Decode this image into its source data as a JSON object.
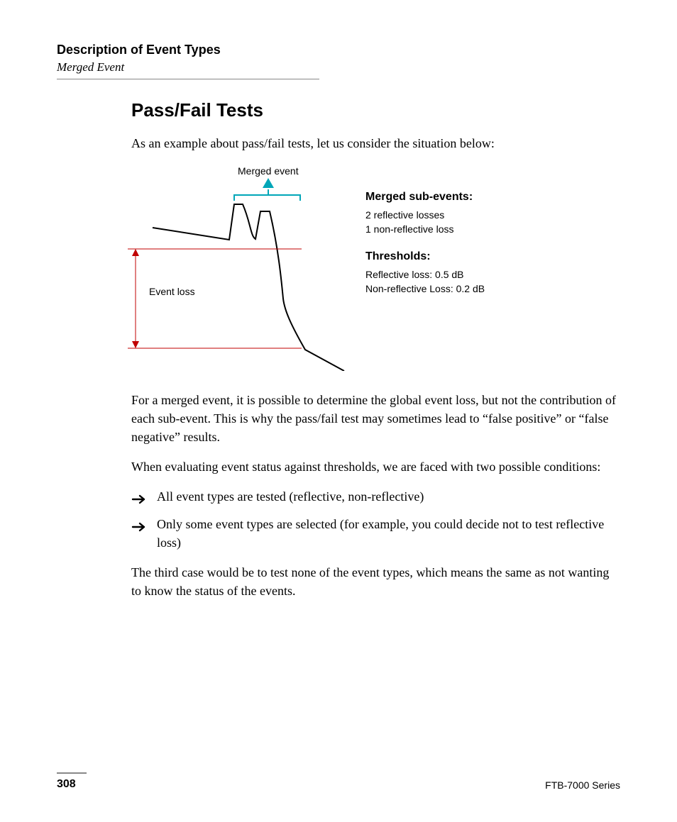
{
  "header": {
    "section_title": "Description of Event Types",
    "section_sub": "Merged Event"
  },
  "title": "Pass/Fail Tests",
  "intro": "As an example about pass/fail tests, let us consider the situation below:",
  "figure": {
    "merged_label": "Merged event",
    "event_loss_label": "Event loss"
  },
  "side": {
    "h1": "Merged sub-events:",
    "l1": "2 reflective losses",
    "l2": "1 non-reflective loss",
    "h2": "Thresholds:",
    "l3": "Reflective loss: 0.5 dB",
    "l4": "Non-reflective Loss: 0.2 dB"
  },
  "para1": "For a merged event, it is possible to determine the global event loss, but not the contribution of each sub-event. This is why the pass/fail test may sometimes lead to “false positive” or “false negative” results.",
  "para2": "When evaluating event status against thresholds, we are faced with two possible conditions:",
  "bullets": [
    "All event types are tested (reflective, non-reflective)",
    "Only some event types are selected (for example, you could decide not to test reflective loss)"
  ],
  "para3": "The third case would be to test none of the event types, which means the same as not wanting to know the status of the events.",
  "footer": {
    "page": "308",
    "series": "FTB-7000 Series"
  }
}
